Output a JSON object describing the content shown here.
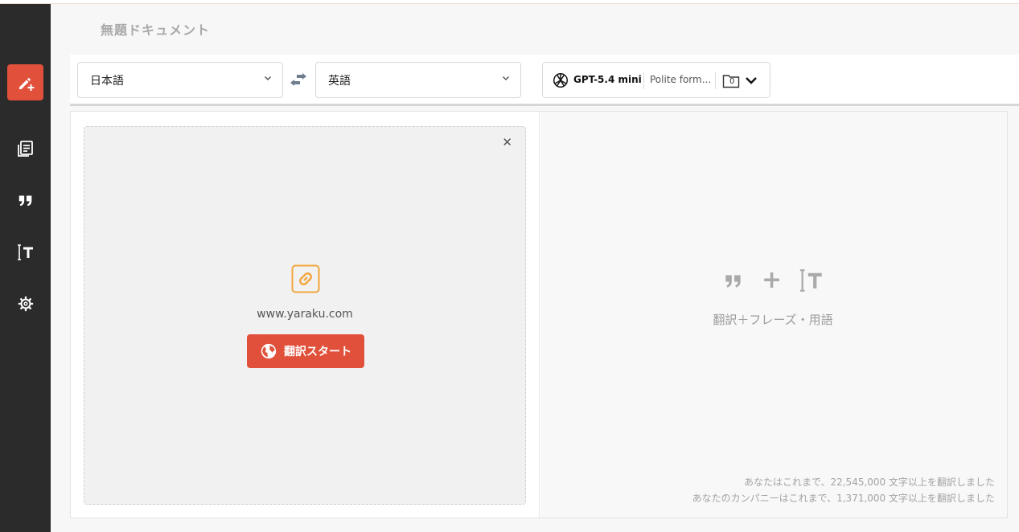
{
  "document": {
    "title": "無題ドキュメント"
  },
  "sidebar": {
    "items": [
      {
        "name": "new-translation",
        "icon": "pen-plus-icon",
        "active": true
      },
      {
        "name": "documents",
        "icon": "documents-icon"
      },
      {
        "name": "phrases",
        "icon": "quote-icon"
      },
      {
        "name": "terms",
        "icon": "text-cursor-t-icon"
      },
      {
        "name": "settings",
        "icon": "gear-icon"
      }
    ]
  },
  "toolbar": {
    "source_language": "日本語",
    "target_language": "英語",
    "model_name": "GPT-5.4 mini",
    "style": "Polite form...",
    "folder_count": "0"
  },
  "left_panel": {
    "url": "www.yaraku.com",
    "start_button": "翻訳スタート"
  },
  "right_panel": {
    "feature_label": "翻訳＋フレーズ・用語",
    "stats_user": "あなたはこれまで、22,545,000 文字以上を翻訳しました",
    "stats_company": "あなたのカンパニーはこれまで、1,371,000 文字以上を翻訳しました"
  },
  "colors": {
    "accent": "#e1503a",
    "sidebar": "#2b2b2b",
    "link_icon": "#f2a63c"
  }
}
